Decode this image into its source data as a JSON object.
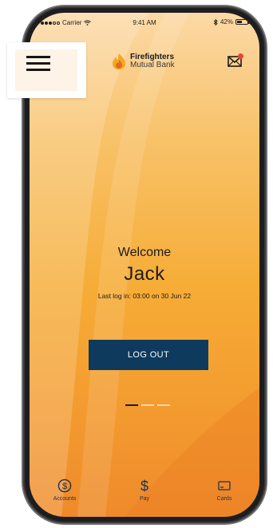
{
  "status_bar": {
    "carrier": "Carrier",
    "time": "9:41 AM",
    "battery": "42%"
  },
  "brand": {
    "name": "Firefighters",
    "subtitle": "Mutual Bank",
    "logo_icon": "flame-icon"
  },
  "header": {
    "menu_icon": "hamburger-menu-icon",
    "mail_icon": "mail-icon",
    "has_notification": true
  },
  "welcome": {
    "greeting": "Welcome",
    "user_name": "Jack",
    "last_login": "Last log in: 03:00 on 30 Jun 22"
  },
  "actions": {
    "logout_label": "LOG OUT"
  },
  "pager": {
    "pages": 3,
    "active_index": 0
  },
  "tab_bar": {
    "tabs": [
      {
        "label": "Accounts",
        "icon": "dollar-circle-icon"
      },
      {
        "label": "Pay",
        "icon": "dollar-icon"
      },
      {
        "label": "Cards",
        "icon": "card-icon"
      }
    ]
  },
  "colors": {
    "accent_dark": "#0e3a5d",
    "gradient_top": "#fcd9a6",
    "gradient_bottom": "#ef8a2a",
    "notification": "#e84434"
  }
}
